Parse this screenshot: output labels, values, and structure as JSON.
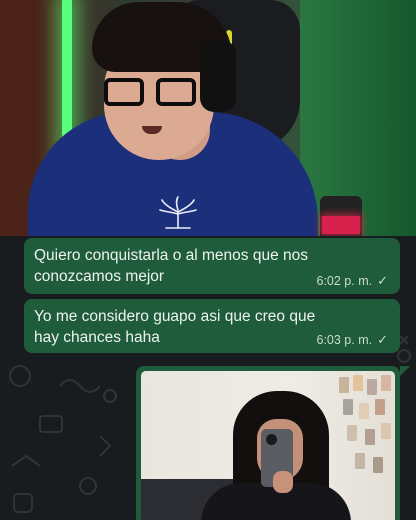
{
  "chat": {
    "messages": [
      {
        "text": "Quiero conquistarla o al menos que nos conozcamos mejor",
        "time": "6:02 p. m.",
        "status": "✓"
      },
      {
        "text": "Yo me considero guapo asi que creo que hay chances haha",
        "time": "6:03 p. m.",
        "status": "✓"
      }
    ],
    "colors": {
      "bubble": "#1f5c3c",
      "background": "#191c1f",
      "meta_text": "#c9dccf"
    }
  }
}
